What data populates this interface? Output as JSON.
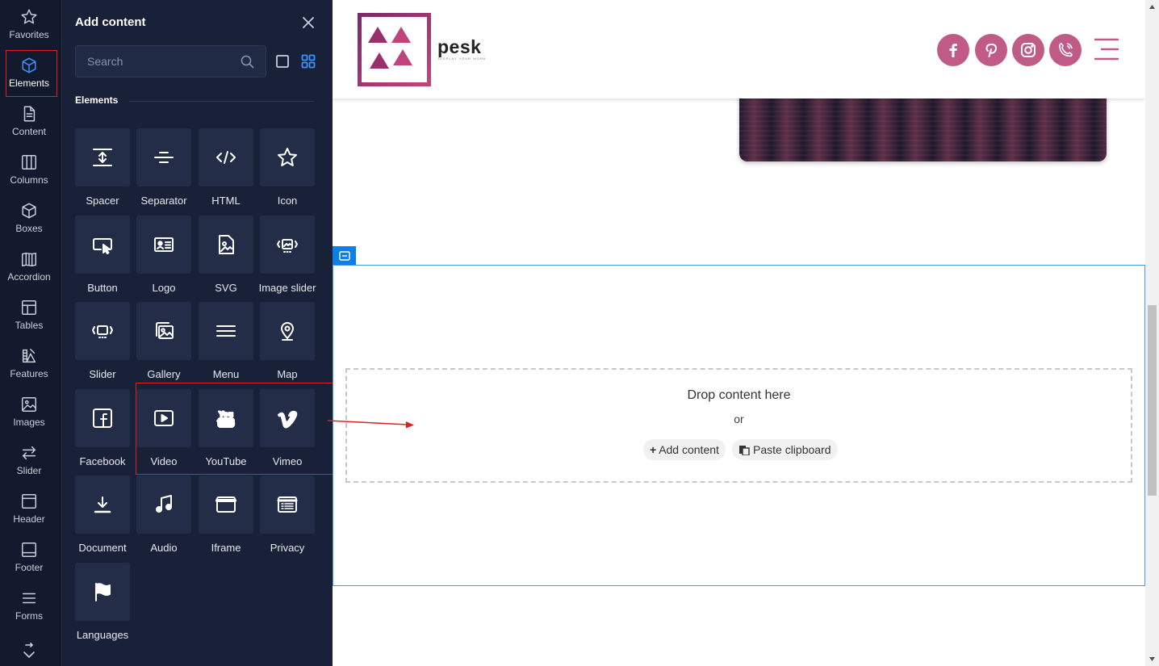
{
  "rail": {
    "items": [
      {
        "label": "Favorites",
        "icon": "star-icon"
      },
      {
        "label": "Elements",
        "icon": "cube-icon",
        "active": true
      },
      {
        "label": "Content",
        "icon": "document-icon"
      },
      {
        "label": "Columns",
        "icon": "columns-icon"
      },
      {
        "label": "Boxes",
        "icon": "box-icon"
      },
      {
        "label": "Accordion",
        "icon": "accordion-icon"
      },
      {
        "label": "Tables",
        "icon": "table-icon"
      },
      {
        "label": "Features",
        "icon": "features-icon"
      },
      {
        "label": "Images",
        "icon": "image-icon"
      },
      {
        "label": "Slider",
        "icon": "arrows-swap-icon"
      },
      {
        "label": "Header",
        "icon": "header-icon"
      },
      {
        "label": "Footer",
        "icon": "footer-icon"
      },
      {
        "label": "Forms",
        "icon": "forms-icon"
      }
    ]
  },
  "panel": {
    "title": "Add content",
    "search_placeholder": "Search",
    "section_title": "Elements",
    "tiles": [
      {
        "label": "Spacer",
        "icon": "spacer-icon"
      },
      {
        "label": "Separator",
        "icon": "separator-icon"
      },
      {
        "label": "HTML",
        "icon": "code-icon"
      },
      {
        "label": "Icon",
        "icon": "star-icon"
      },
      {
        "label": "Button",
        "icon": "button-icon"
      },
      {
        "label": "Logo",
        "icon": "logo-card-icon"
      },
      {
        "label": "SVG",
        "icon": "svg-file-icon"
      },
      {
        "label": "Image slider",
        "icon": "image-slider-icon"
      },
      {
        "label": "Slider",
        "icon": "slider-icon"
      },
      {
        "label": "Gallery",
        "icon": "gallery-icon"
      },
      {
        "label": "Menu",
        "icon": "menu-icon"
      },
      {
        "label": "Map",
        "icon": "map-pin-icon"
      },
      {
        "label": "Facebook",
        "icon": "facebook-icon"
      },
      {
        "label": "Video",
        "icon": "video-icon"
      },
      {
        "label": "YouTube",
        "icon": "youtube-icon"
      },
      {
        "label": "Vimeo",
        "icon": "vimeo-icon"
      },
      {
        "label": "Document",
        "icon": "download-icon"
      },
      {
        "label": "Audio",
        "icon": "music-icon"
      },
      {
        "label": "Iframe",
        "icon": "iframe-icon"
      },
      {
        "label": "Privacy",
        "icon": "privacy-icon"
      },
      {
        "label": "Languages",
        "icon": "flag-icon"
      }
    ]
  },
  "site": {
    "brand_name": "pesk",
    "brand_tagline": "DISPLAY YOUR WORK",
    "social": [
      "facebook-icon",
      "pinterest-icon",
      "instagram-icon",
      "phone-icon"
    ],
    "accent_color": "#c05a86"
  },
  "drop_zone": {
    "title": "Drop content here",
    "or": "or",
    "add_label": "Add content",
    "paste_label": "Paste clipboard"
  },
  "colors": {
    "rail_bg": "#131a2e",
    "panel_bg": "#192138",
    "tile_bg": "#232d48",
    "active_blue": "#3b93ff",
    "annotation_red": "#e02020"
  }
}
